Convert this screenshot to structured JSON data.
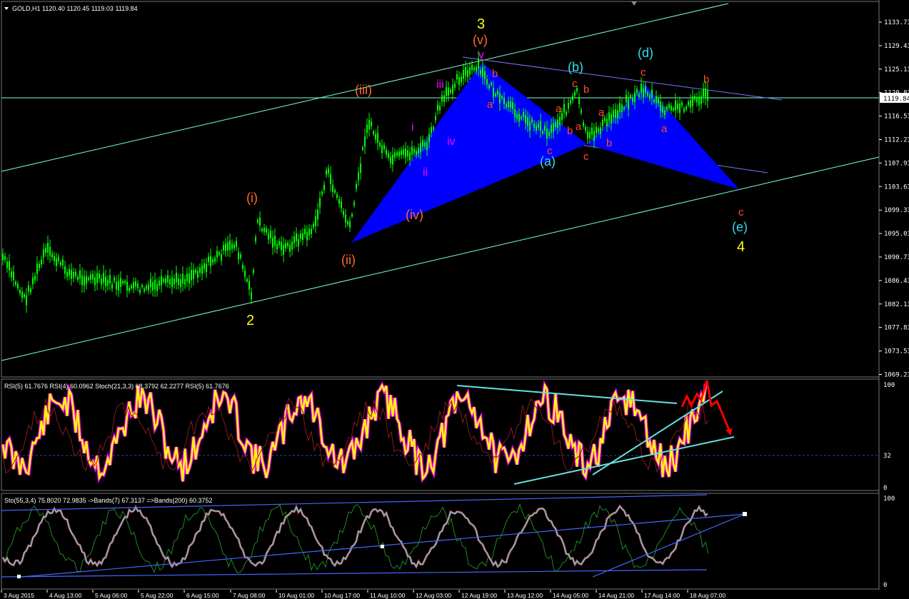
{
  "header": {
    "main_title": "GOLD,H1  1120.40 1120.45 1119.03 1119.84",
    "rsi_title": "RSI(5) 61.7676  RSI(4) 60.0962  Stoch(21,3,3) 68.3792 62.2277  RSI(5) 61.7676",
    "sto_title": "Sto(55,3,4) 75.8020 72.9835  ->Bands(7) 67.3137  =>Bands(200) 60.3752"
  },
  "price_axis": {
    "ticks": [
      "1133.73",
      "1129.43",
      "1125.13",
      "1120.83",
      "1116.53",
      "1112.23",
      "1107.93",
      "1103.63",
      "1099.33",
      "1095.03",
      "1090.73",
      "1086.43",
      "1082.13",
      "1077.83",
      "1073.53",
      "1069.23"
    ],
    "current_price": "1119.84"
  },
  "rsi_axis": {
    "ticks": [
      "100",
      "32",
      "0"
    ]
  },
  "sto_axis": {
    "ticks": [
      "100",
      "0"
    ]
  },
  "time_axis": {
    "ticks": [
      "3 Aug 2015",
      "4 Aug 13:00",
      "5 Aug 06:00",
      "5 Aug 22:00",
      "6 Aug 15:00",
      "7 Aug 08:00",
      "10 Aug 01:00",
      "10 Aug 17:00",
      "11 Aug 10:00",
      "12 Aug 03:00",
      "12 Aug 19:00",
      "13 Aug 12:00",
      "14 Aug 05:00",
      "14 Aug 21:00",
      "17 Aug 14:00",
      "18 Aug 07:00"
    ]
  },
  "wave_labels": {
    "w2": "2",
    "w3": "3",
    "w4": "4",
    "i": "(i)",
    "ii": "(ii)",
    "iii": "(iii)",
    "iv": "(iv)",
    "v": "(v)",
    "si": "i",
    "sii": "ii",
    "siii": "iii",
    "siv": "iv",
    "sv": "v",
    "a_paren": "(a)",
    "b_paren": "(b)",
    "d_paren": "(d)",
    "e_paren": "(e)",
    "a1": "a",
    "b1": "b",
    "c1": "c",
    "a2": "a",
    "b2": "b",
    "c2": "c",
    "a3": "a",
    "b3": "b",
    "c3": "c",
    "a4": "a",
    "b4": "b",
    "c4": "c",
    "b5": "b",
    "c5": "c"
  },
  "colors": {
    "background": "#000000",
    "candles": "#00ff00",
    "channel": "#7fffd4",
    "pattern_fill": "#0000ff",
    "wave_yellow": "#ffff00",
    "wave_orange": "#ff6a2a",
    "wave_magenta": "#ff00ff",
    "wave_cyan": "#33ddee",
    "rsi_main": "#ffff00",
    "rsi_shadow": "#ff00ff",
    "arrow_red": "#ff0000",
    "axis_text": "#ffffff",
    "grid_level": "#3344aa"
  }
}
